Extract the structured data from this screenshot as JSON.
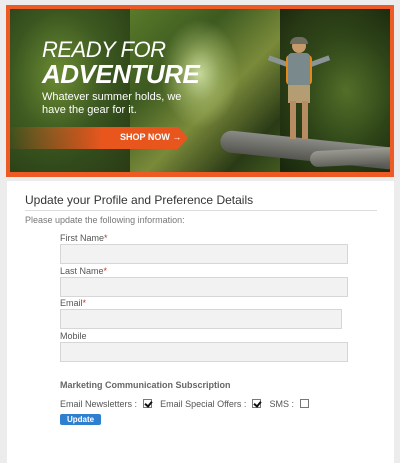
{
  "banner": {
    "headline_line1": "READY FOR",
    "headline_line2": "ADVENTURE",
    "subtext": "Whatever summer holds, we have the gear for it.",
    "shop_label": "SHOP NOW →",
    "accent_color": "#ee5a23"
  },
  "form": {
    "title": "Update your Profile and Preference Details",
    "intro": "Please update the following information:",
    "fields": [
      {
        "label": "First Name",
        "required": "*",
        "value": ""
      },
      {
        "label": "Last Name",
        "required": "*",
        "value": ""
      },
      {
        "label": "Email",
        "required": "*",
        "value": ""
      },
      {
        "label": "Mobile",
        "required": "",
        "value": ""
      }
    ],
    "subscription_title": "Marketing Communication Subscription",
    "options": [
      {
        "label": "Email Newsletters :",
        "checked": true
      },
      {
        "label": "Email Special Offers :",
        "checked": true
      },
      {
        "label": "SMS :",
        "checked": false
      }
    ],
    "update_label": "Update",
    "button_color": "#2f7fd1"
  }
}
